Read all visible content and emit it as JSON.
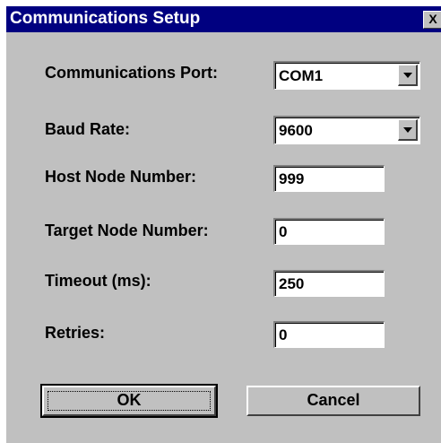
{
  "window": {
    "title": "Communications Setup",
    "close_label": "X"
  },
  "form": {
    "comm_port": {
      "label": "Communications Port:",
      "value": "COM1"
    },
    "baud_rate": {
      "label": "Baud Rate:",
      "value": "9600"
    },
    "host_node": {
      "label": "Host Node Number:",
      "value": "999"
    },
    "target_node": {
      "label": "Target Node Number:",
      "value": "0"
    },
    "timeout": {
      "label": "Timeout (ms):",
      "value": "250"
    },
    "retries": {
      "label": "Retries:",
      "value": "0"
    }
  },
  "buttons": {
    "ok_label": "OK",
    "cancel_label": "Cancel"
  },
  "colors": {
    "titlebar": "#000080",
    "dialog_bg": "#c0c0c0"
  }
}
